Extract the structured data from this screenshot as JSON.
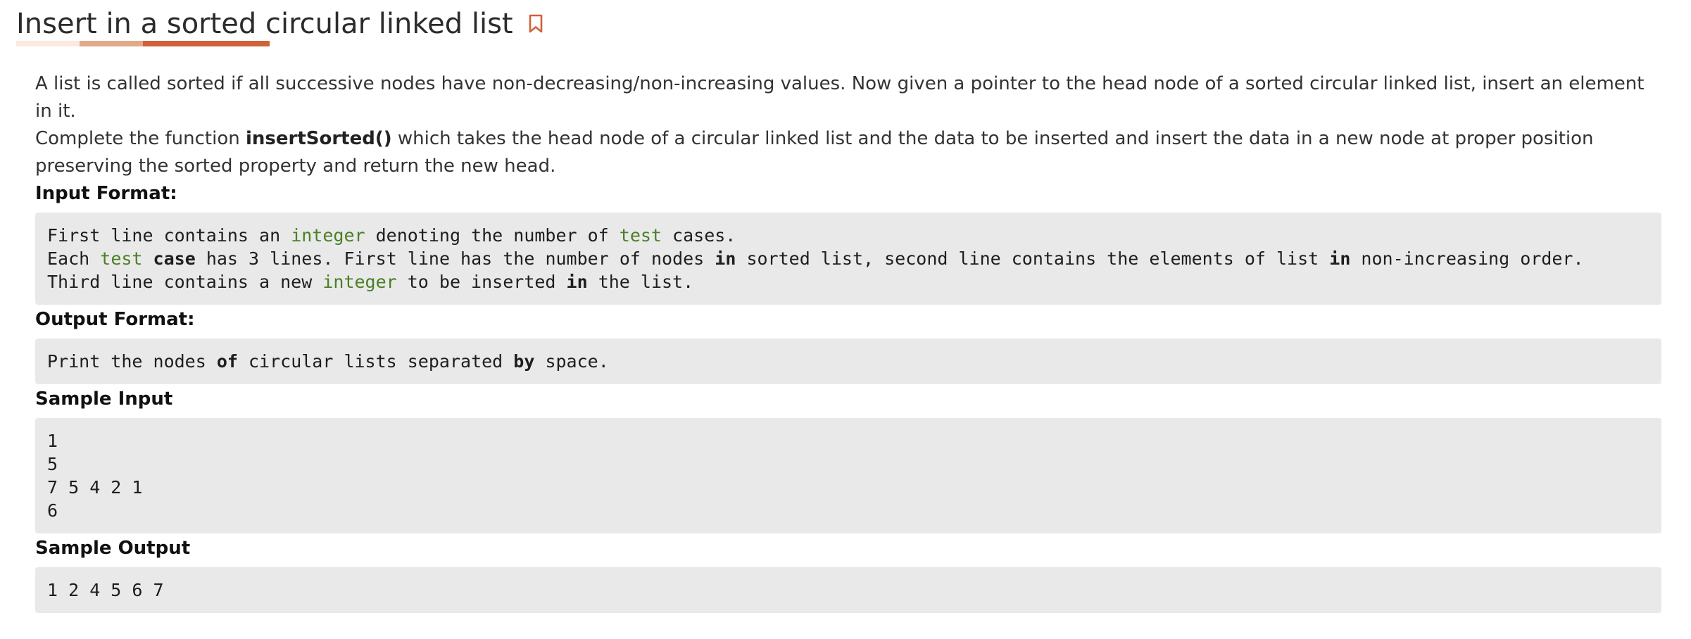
{
  "header": {
    "title": "Insert in a sorted circular linked list",
    "bookmark_icon": "bookmark-icon",
    "accent_color": "#d0623a"
  },
  "description": {
    "line1": "A list is called sorted if all successive nodes have non-decreasing/non-increasing values. Now given a pointer to the head node of a sorted circular linked list, insert an element in it.",
    "line2_prefix": "Complete the function ",
    "line2_function": "insertSorted()",
    "line2_suffix": " which takes the head node of a circular linked list and the data to be inserted and insert the data in a new node at proper position preserving the sorted property and return the new head."
  },
  "input_format": {
    "label": "Input Format:",
    "lines": [
      [
        {
          "t": "First line contains an ",
          "s": ""
        },
        {
          "t": "integer",
          "s": "green"
        },
        {
          "t": " denoting the number of ",
          "s": ""
        },
        {
          "t": "test",
          "s": "green"
        },
        {
          "t": " cases.",
          "s": ""
        }
      ],
      [
        {
          "t": "Each ",
          "s": ""
        },
        {
          "t": "test",
          "s": "green"
        },
        {
          "t": " ",
          "s": ""
        },
        {
          "t": "case",
          "s": "bold"
        },
        {
          "t": " has 3 lines. First line has the number of nodes ",
          "s": ""
        },
        {
          "t": "in",
          "s": "bold"
        },
        {
          "t": " sorted list, second line contains the elements of list ",
          "s": ""
        },
        {
          "t": "in",
          "s": "bold"
        },
        {
          "t": " non-increasing order.",
          "s": ""
        }
      ],
      [
        {
          "t": "Third line contains a new ",
          "s": ""
        },
        {
          "t": "integer",
          "s": "green"
        },
        {
          "t": " to be inserted ",
          "s": ""
        },
        {
          "t": "in",
          "s": "bold"
        },
        {
          "t": " the list.",
          "s": ""
        }
      ]
    ]
  },
  "output_format": {
    "label": "Output Format:",
    "lines": [
      [
        {
          "t": "Print the nodes ",
          "s": ""
        },
        {
          "t": "of",
          "s": "bold"
        },
        {
          "t": " circular lists separated ",
          "s": ""
        },
        {
          "t": "by",
          "s": "bold"
        },
        {
          "t": " space.",
          "s": ""
        }
      ]
    ]
  },
  "sample_input": {
    "label": "Sample Input",
    "text": "1\n5\n7 5 4 2 1\n6"
  },
  "sample_output": {
    "label": "Sample Output",
    "text": "1 2 4 5 6 7"
  }
}
